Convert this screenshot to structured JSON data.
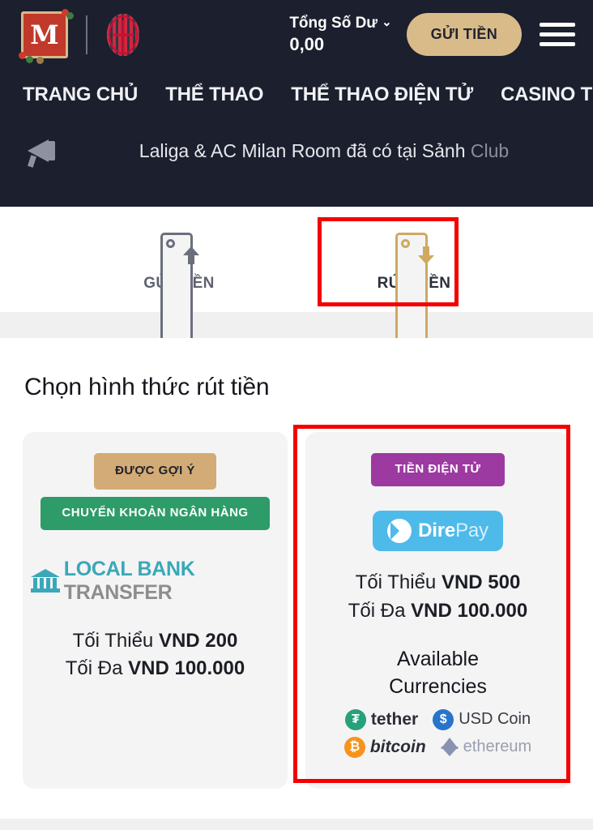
{
  "header": {
    "logo_letter": "M",
    "logo_name": "m-logo",
    "partner_name": "ac-milan-crest",
    "balance_label": "Tổng Số Dư",
    "balance_chevron": "⌄",
    "balance_value": "0,00",
    "deposit_button": "GỬI TIỀN",
    "menu_icon": "hamburger-menu"
  },
  "nav": {
    "items": [
      {
        "label": "TRANG CHỦ"
      },
      {
        "label": "THỂ THAO"
      },
      {
        "label": "THỂ THAO ĐIỆN TỬ"
      },
      {
        "label": "CASINO TRỰC TUY"
      }
    ]
  },
  "announcement": {
    "icon": "megaphone-icon",
    "text_visible": "Laliga & AC Milan Room đã có tại Sảnh ",
    "text_fading": "Club"
  },
  "tabs": [
    {
      "label": "GỬI TIỀN",
      "icon": "wallet-up-arrow-icon",
      "active": false
    },
    {
      "label": "RÚT TIỀN",
      "icon": "wallet-down-arrow-icon",
      "active": true
    }
  ],
  "main": {
    "section_title": "Chọn hình thức rút tiền",
    "methods": [
      {
        "badge_recommended": "ĐƯỢC GỢI Ý",
        "badge_type": "CHUYỂN KHOẢN NGÂN HÀNG",
        "logo_part1": "LOCAL",
        "logo_part2": "BANK",
        "logo_part3": "TRANSFER",
        "min_label": "Tối Thiểu",
        "min_value": "VND 200",
        "max_label": "Tối Đa",
        "max_value": "VND 100.000"
      },
      {
        "badge_type": "TIỀN ĐIỆN TỬ",
        "logo_part1": "Dire",
        "logo_part2": "Pay",
        "min_label": "Tối Thiểu",
        "min_value": "VND 500",
        "max_label": "Tối Đa",
        "max_value": "VND 100.000",
        "available_line1": "Available",
        "available_line2": "Currencies",
        "currencies": [
          {
            "name": "tether",
            "symbol": "₮"
          },
          {
            "name": "USD Coin",
            "symbol": "$"
          },
          {
            "name": "bitcoin",
            "symbol": "₿"
          },
          {
            "name": "ethereum",
            "symbol": ""
          }
        ]
      }
    ]
  },
  "colors": {
    "header_bg": "#1b1f2e",
    "accent_gold": "#d9bb8a",
    "highlight_red": "#f40000",
    "badge_tan": "#d2ab76",
    "badge_green": "#2e9c68",
    "badge_purple": "#9c3aa1",
    "direpay_blue": "#4dbaea",
    "bank_teal": "#3aa8b8"
  }
}
